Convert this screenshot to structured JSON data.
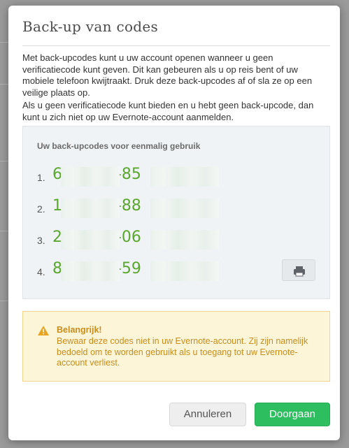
{
  "dialog": {
    "title": "Back-up van codes",
    "paragraph1": "Met back-upcodes kunt u uw account openen wanneer u geen verificatiecode kunt geven. Dit kan gebeuren als u op reis bent of uw mobiele telefoon kwijtraakt. Druk deze back-upcodes af of sla ze op een veilige plaats op.",
    "paragraph2": "Als u geen verificatiecode kunt bieden en u hebt geen back-upcode, dan kunt u zich niet op uw Evernote-account aanmelden."
  },
  "codes": {
    "heading": "Uw back-upcodes voor eenmalig gebruik",
    "items": [
      {
        "num": "1.",
        "text": "6         5-85"
      },
      {
        "num": "2.",
        "text": "1         0-88"
      },
      {
        "num": "3.",
        "text": "2         7-06"
      },
      {
        "num": "4.",
        "text": "8         9-59"
      }
    ],
    "print_icon": "printer-icon"
  },
  "warning": {
    "icon": "warning-icon",
    "title": "Belangrijk!",
    "body": "Bewaar deze codes niet in uw Evernote-account. Zij zijn namelijk bedoeld om te worden gebruikt als u toegang tot uw Evernote-account verliest."
  },
  "buttons": {
    "cancel": "Annuleren",
    "continue": "Doorgaan"
  },
  "colors": {
    "accent": "#2dbe60",
    "code_text": "#5aa72d",
    "warning_text": "#c98d1b",
    "warning_bg": "#fdf5d8"
  }
}
